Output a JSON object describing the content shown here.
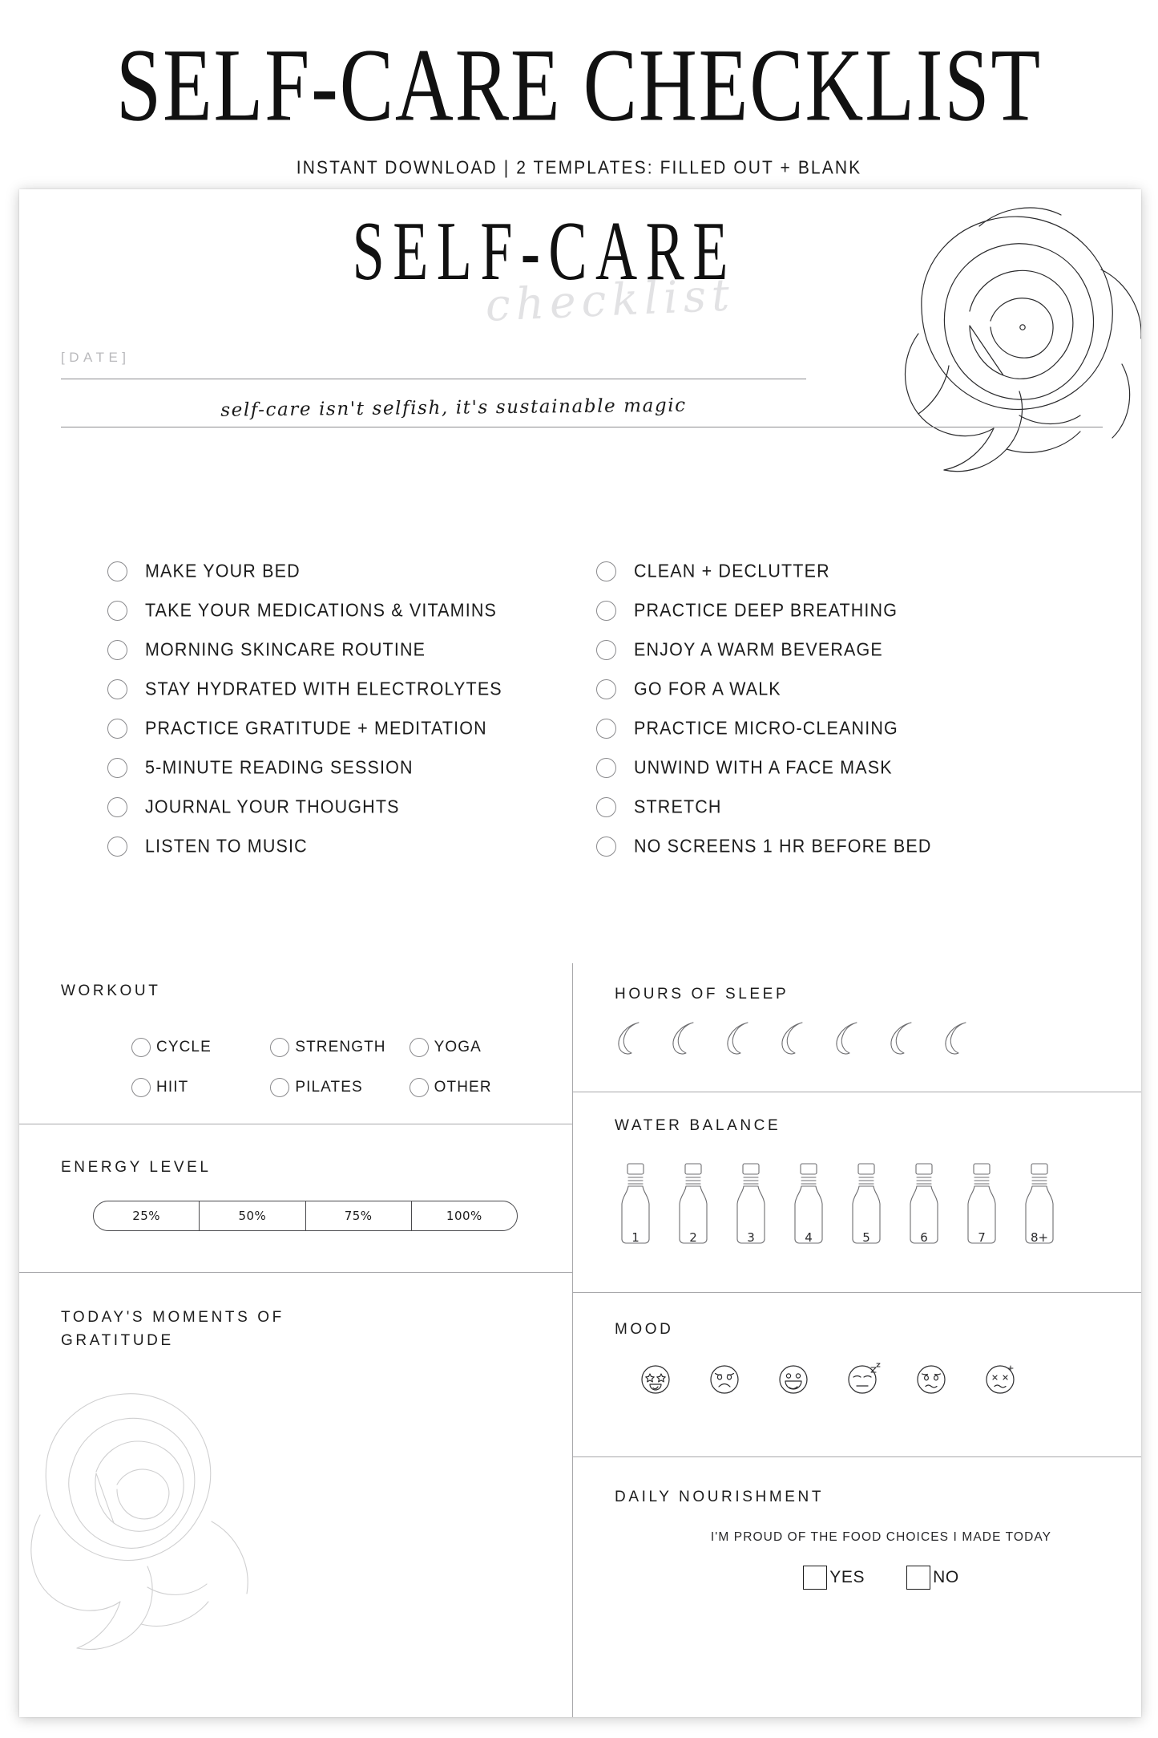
{
  "masthead": {
    "title": "SELF-CARE CHECKLIST",
    "subtitle": "INSTANT DOWNLOAD | 2 TEMPLATES: FILLED OUT + BLANK"
  },
  "card": {
    "logo_main": "SELF-CARE",
    "logo_script": "checklist",
    "date_label": "[DATE]",
    "tagline": "self-care isn't selfish, it's sustainable magic"
  },
  "checklist": {
    "left": [
      "MAKE YOUR BED",
      "TAKE YOUR MEDICATIONS & VITAMINS",
      "MORNING SKINCARE ROUTINE",
      "STAY HYDRATED WITH ELECTROLYTES",
      "PRACTICE GRATITUDE + MEDITATION",
      "5-MINUTE READING SESSION",
      "JOURNAL YOUR THOUGHTS",
      "LISTEN TO MUSIC"
    ],
    "right": [
      "CLEAN + DECLUTTER",
      "PRACTICE DEEP BREATHING",
      "ENJOY A WARM BEVERAGE",
      "GO FOR A WALK",
      "PRACTICE MICRO-CLEANING",
      "UNWIND WITH A FACE MASK",
      "STRETCH",
      "NO SCREENS 1 HR BEFORE BED"
    ]
  },
  "workout": {
    "title": "WORKOUT",
    "options": [
      "CYCLE",
      "STRENGTH",
      "YOGA",
      "HIIT",
      "PILATES",
      "OTHER"
    ]
  },
  "energy": {
    "title": "ENERGY LEVEL",
    "levels": [
      "25%",
      "50%",
      "75%",
      "100%"
    ]
  },
  "gratitude": {
    "title_line1": "TODAY'S MOMENTS OF",
    "title_line2": "GRATITUDE"
  },
  "sleep": {
    "title": "HOURS OF SLEEP",
    "count": 7
  },
  "water": {
    "title": "WATER BALANCE",
    "labels": [
      "1",
      "2",
      "3",
      "4",
      "5",
      "6",
      "7",
      "8+"
    ]
  },
  "mood": {
    "title": "MOOD",
    "faces": [
      "star-struck-face",
      "sad-face",
      "laughing-face",
      "sleeping-annoyed-face",
      "worried-face",
      "dizzy-face"
    ]
  },
  "nourishment": {
    "title": "DAILY NOURISHMENT",
    "subtitle": "I'M PROUD OF THE FOOD CHOICES I MADE TODAY",
    "yes_label": "YES",
    "no_label": "NO"
  },
  "colors": {
    "ink": "#1c1c1c",
    "rule": "#8d8d90",
    "circle": "#8a8a8d",
    "script_gray": "#e2e2e4"
  }
}
